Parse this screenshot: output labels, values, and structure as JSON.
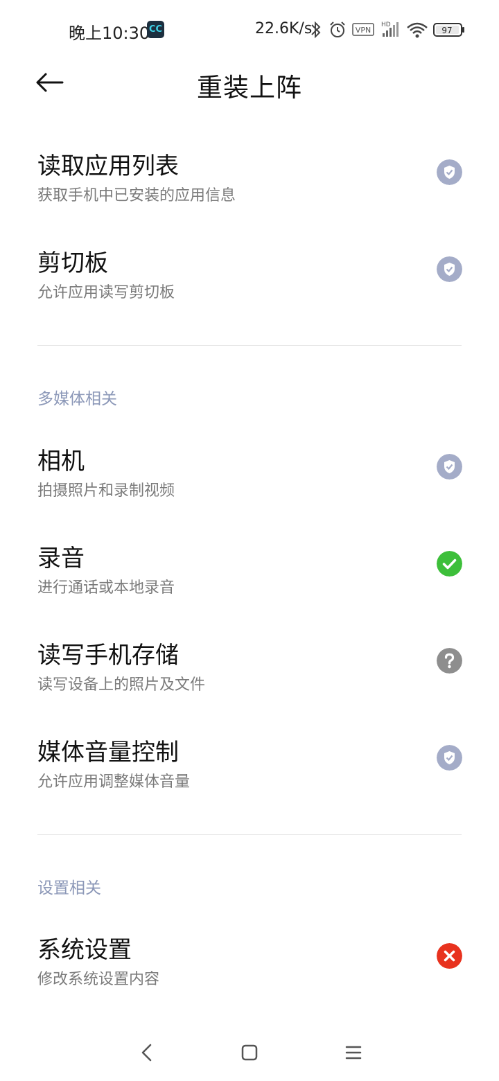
{
  "status_bar": {
    "time": "晚上10:30",
    "app_icon_text": "CC",
    "network_speed": "22.6K/s",
    "vpn_label": "VPN",
    "signal_label": "HD",
    "battery_level": "97"
  },
  "header": {
    "title": "重装上阵"
  },
  "colors": {
    "granted_gray": "#a4acc8",
    "allowed_green": "#3dbf3a",
    "unknown_gray": "#8e8e8e",
    "denied_red": "#e8321e",
    "section_header": "#8c98b8"
  },
  "top_items": [
    {
      "title": "读取应用列表",
      "subtitle": "获取手机中已安装的应用信息",
      "status": "shield"
    },
    {
      "title": "剪切板",
      "subtitle": "允许应用读写剪切板",
      "status": "shield"
    }
  ],
  "section_media": {
    "header": "多媒体相关",
    "items": [
      {
        "title": "相机",
        "subtitle": "拍摄照片和录制视频",
        "status": "shield"
      },
      {
        "title": "录音",
        "subtitle": "进行通话或本地录音",
        "status": "check"
      },
      {
        "title": "读写手机存储",
        "subtitle": "读写设备上的照片及文件",
        "status": "question"
      },
      {
        "title": "媒体音量控制",
        "subtitle": "允许应用调整媒体音量",
        "status": "shield"
      }
    ]
  },
  "section_settings": {
    "header": "设置相关",
    "items": [
      {
        "title": "系统设置",
        "subtitle": "修改系统设置内容",
        "status": "cross"
      }
    ]
  },
  "nav_bar": {
    "back_icon": "chevron-left-icon",
    "home_icon": "square-icon",
    "menu_icon": "hamburger-icon"
  }
}
